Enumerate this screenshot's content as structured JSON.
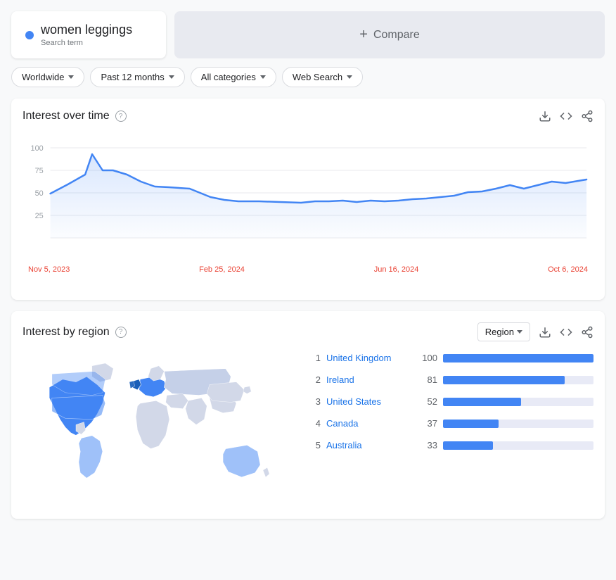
{
  "searchTerm": {
    "title": "women leggings",
    "subtitle": "Search term",
    "dotColor": "#4285f4"
  },
  "compare": {
    "label": "Compare",
    "plusSymbol": "+"
  },
  "filters": [
    {
      "id": "location",
      "label": "Worldwide"
    },
    {
      "id": "time",
      "label": "Past 12 months"
    },
    {
      "id": "category",
      "label": "All categories"
    },
    {
      "id": "type",
      "label": "Web Search"
    }
  ],
  "interestOverTime": {
    "title": "Interest over time",
    "yLabels": [
      "25",
      "50",
      "75",
      "100"
    ],
    "xLabels": [
      "Nov 5, 2023",
      "Feb 25, 2024",
      "Jun 16, 2024",
      "Oct 6, 2024"
    ],
    "downloadIcon": "⬇",
    "embedIcon": "<>",
    "shareIcon": "share"
  },
  "interestByRegion": {
    "title": "Interest by region",
    "filterLabel": "Region",
    "downloadIcon": "⬇",
    "embedIcon": "<>",
    "shareIcon": "share",
    "regions": [
      {
        "rank": 1,
        "name": "United Kingdom",
        "score": 100
      },
      {
        "rank": 2,
        "name": "Ireland",
        "score": 81
      },
      {
        "rank": 3,
        "name": "United States",
        "score": 52
      },
      {
        "rank": 4,
        "name": "Canada",
        "score": 37
      },
      {
        "rank": 5,
        "name": "Australia",
        "score": 33
      }
    ]
  }
}
